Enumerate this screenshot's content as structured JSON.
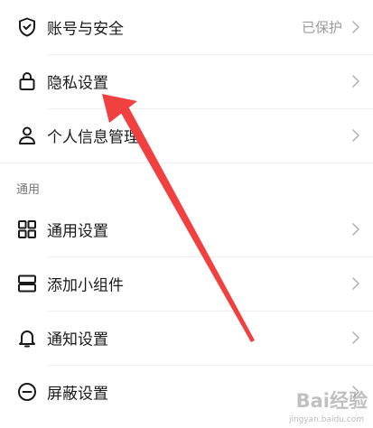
{
  "settings": {
    "items": [
      {
        "label": "账号与安全",
        "value": "已保护",
        "icon": "shield-check-icon"
      },
      {
        "label": "隐私设置",
        "icon": "lock-icon"
      },
      {
        "label": "个人信息管理",
        "icon": "person-icon"
      }
    ],
    "section_general": {
      "title": "通用",
      "items": [
        {
          "label": "通用设置",
          "icon": "grid-icon"
        },
        {
          "label": "添加小组件",
          "icon": "widget-icon"
        },
        {
          "label": "通知设置",
          "icon": "bell-icon"
        },
        {
          "label": "屏蔽设置",
          "icon": "block-icon"
        }
      ]
    }
  },
  "annotation": {
    "arrow_color": "#f04040"
  },
  "watermark": {
    "main": "Bai经验",
    "sub": "jingyan.baidu.com"
  }
}
